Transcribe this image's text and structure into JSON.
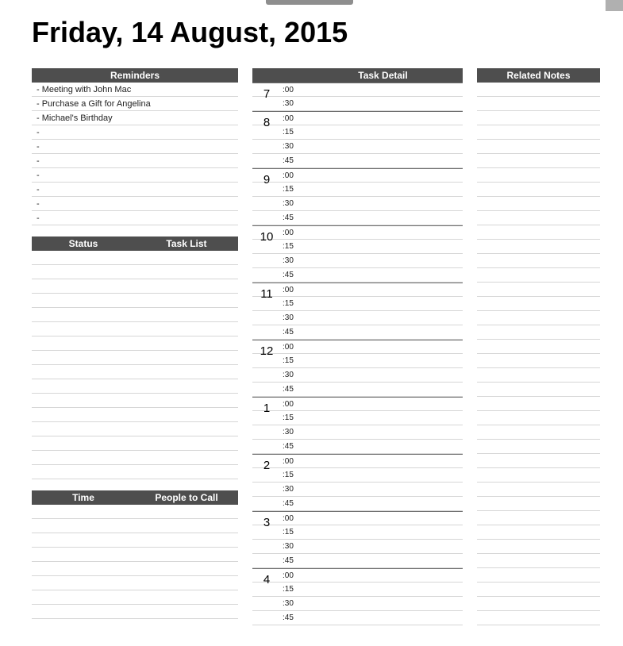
{
  "title": "Friday, 14 August, 2015",
  "reminders": {
    "header": "Reminders",
    "items": [
      "- Meeting with John Mac",
      "- Purchase a Gift for Angelina",
      "- Michael's Birthday",
      "-",
      "-",
      "-",
      "-",
      "-",
      "-",
      "-"
    ]
  },
  "tasklist": {
    "headers": {
      "status": "Status",
      "tasklist": "Task List"
    },
    "row_count": 16
  },
  "calls": {
    "headers": {
      "time": "Time",
      "people": "People to Call"
    },
    "row_count": 8
  },
  "taskdetail": {
    "header": "Task Detail",
    "hours": [
      {
        "label": "7",
        "minutes": [
          ":00",
          ":30"
        ]
      },
      {
        "label": "8",
        "minutes": [
          ":00",
          ":15",
          ":30",
          ":45"
        ]
      },
      {
        "label": "9",
        "minutes": [
          ":00",
          ":15",
          ":30",
          ":45"
        ]
      },
      {
        "label": "10",
        "minutes": [
          ":00",
          ":15",
          ":30",
          ":45"
        ]
      },
      {
        "label": "11",
        "minutes": [
          ":00",
          ":15",
          ":30",
          ":45"
        ]
      },
      {
        "label": "12",
        "minutes": [
          ":00",
          ":15",
          ":30",
          ":45"
        ]
      },
      {
        "label": "1",
        "minutes": [
          ":00",
          ":15",
          ":30",
          ":45"
        ]
      },
      {
        "label": "2",
        "minutes": [
          ":00",
          ":15",
          ":30",
          ":45"
        ]
      },
      {
        "label": "3",
        "minutes": [
          ":00",
          ":15",
          ":30",
          ":45"
        ]
      },
      {
        "label": "4",
        "minutes": [
          ":00",
          ":15",
          ":30",
          ":45"
        ]
      }
    ]
  },
  "notes": {
    "header": "Related Notes",
    "row_count": 38
  }
}
